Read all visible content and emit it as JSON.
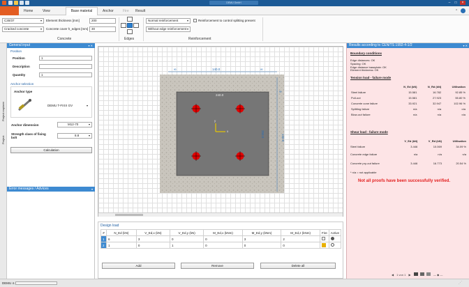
{
  "window": {
    "title": "DEMU GmbH"
  },
  "menu": {
    "tabs": [
      "Home",
      "View",
      "Base material",
      "Anchor",
      "Fire",
      "Result"
    ]
  },
  "ribbon": {
    "concrete_grade": "C30/37",
    "cracked": "Cracked concrete",
    "thickness_label": "Element thickness [mm]",
    "thickness_value": "200",
    "cover_label": "Concrete cover h_edges [mm]",
    "cover_value": "30",
    "concrete_group": "Concrete",
    "edges_group": "Edges",
    "reinf_type": "Normal reinforcement",
    "edge_reinf": "Without edge reinforcement",
    "splitting_label": "Reinforcement to control splitting present",
    "reinf_group": "Reinforcement"
  },
  "left_tabs": [
    "Project explorer",
    "Project"
  ],
  "general_input": {
    "header": "General input",
    "position_section": "Position",
    "position_label": "Position",
    "position_value": "1",
    "description_label": "Description",
    "quantity_label": "Quantity",
    "quantity_value": "1",
    "anchor_section": "Anchor selection",
    "anchor_type_label": "Anchor type",
    "anchor_name": "DEMU T-FIXX GV",
    "anchor_dim_label": "Anchor dimension",
    "anchor_dim_value": "M12-70",
    "strength_label": "Strength class of fixing bolt",
    "strength_value": "8.8",
    "calc_button": "Calculation"
  },
  "errors": {
    "header": "Error messages / Advices"
  },
  "drawing": {
    "plate_label": "240.0",
    "dim_top_left": "∞",
    "dim_top_mid": "140.0",
    "dim_top_right": "∞",
    "dim_right_side": "∞",
    "dim_right_mid": "140.0",
    "dim_plate_side": "250.0",
    "axis_x": "x",
    "axis_y": "y"
  },
  "design_load": {
    "header": "Design load",
    "columns": [
      "#",
      "N_Ed (kN)",
      "V_Ed,x (kN)",
      "V_Ed,y (kN)",
      "M_Ed,x (kNm)",
      "M_Ed,y (kNm)",
      "M_Ed,z (kNm)",
      "Fire",
      "Active"
    ],
    "rows": [
      [
        "1",
        "6",
        "3",
        "0",
        "0",
        "3",
        "2"
      ],
      [
        "2",
        "1",
        "0",
        "1",
        "0",
        "0",
        "0"
      ]
    ],
    "add_button": "Add",
    "remove_button": "Remove",
    "delete_button": "Delete all"
  },
  "results": {
    "header": "Results according to CEN/TS 1992-4-1/2",
    "boundary_title": "Boundary conditions",
    "boundary_lines": [
      "Edge distances: OK",
      "Spacing: OK",
      "Edge distance baseplate: OK",
      "Element thickness: OK"
    ],
    "tension_title": "Tension load - failure mode",
    "tension_cols": [
      "N_Ed (kN)",
      "N_Rd (kN)",
      "Utilisation"
    ],
    "tension_rows": [
      [
        "Steel failure",
        "15.581",
        "16.782",
        "92.85 %"
      ],
      [
        "Pull-out",
        "15.581",
        "27.923",
        "55.80 %"
      ],
      [
        "Concrete cone failure",
        "33.921",
        "32.947",
        "102.96 %"
      ],
      [
        "Splitting failure",
        "n/a",
        "n/a",
        "n/a"
      ],
      [
        "Blow-out failure",
        "n/a",
        "n/a",
        "n/a"
      ]
    ],
    "shear_title": "Shear load - failure mode",
    "shear_cols": [
      "V_Ed (kN)",
      "V_Rd (kN)",
      "Utilisation"
    ],
    "shear_rows": [
      [
        "Steel failure",
        "3.446",
        "10.069",
        "34.09 %"
      ],
      [
        "Concrete edge failure",
        "n/a",
        "n/a",
        "n/a"
      ],
      [
        "Concrete pry-out failure",
        "3.446",
        "16.773",
        "20.54 %"
      ]
    ],
    "note": "* n/a = not applicable",
    "verdict": "Not all proofs have been successfully verified.",
    "pager": "1 von 1"
  },
  "status": {
    "version": "DEMU 4.1"
  },
  "colors": {
    "accent": "#3d8ad1",
    "title_bar": "#1c5a96",
    "results_bg": "#fde4e6",
    "verdict": "#e32020",
    "bolt": "#e00000"
  }
}
